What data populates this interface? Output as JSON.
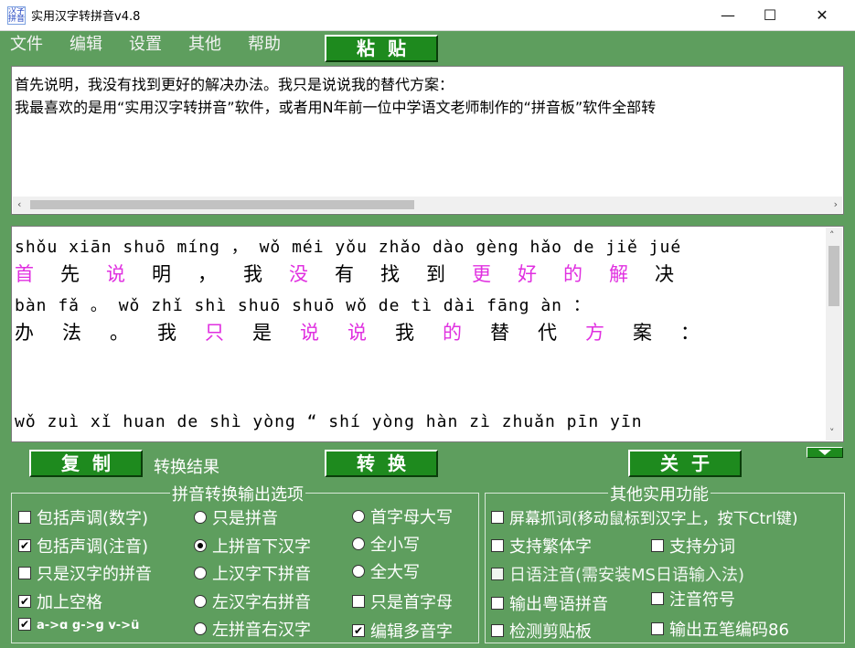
{
  "window": {
    "title": "实用汉字转拼音v4.8",
    "icon_text": "汉字拼音",
    "minimize": "—",
    "maximize": "☐",
    "close": "✕"
  },
  "menu": [
    "文件",
    "编辑",
    "设置",
    "其他",
    "帮助"
  ],
  "buttons": {
    "paste": "粘贴",
    "copy": "复制",
    "convert": "转换",
    "about": "关于"
  },
  "input": {
    "lines": [
      "首先说明，我没有找到更好的解决办法。我只是说说我的替代方案：",
      "我最喜欢的是用“实用汉字转拼音”软件，或者用N年前一位中学语文老师制作的“拼音板”软件全部转"
    ]
  },
  "result_label": "转换结果",
  "result": {
    "pinyin1": "shǒu xiān shuō míng ，  wǒ méi yǒu zhǎo dào gèng hǎo de jiě jué",
    "hanzi1": [
      {
        "t": "首",
        "m": true
      },
      {
        "t": "先",
        "m": false
      },
      {
        "t": "说",
        "m": true
      },
      {
        "t": "明",
        "m": false
      },
      {
        "t": "，",
        "m": false
      },
      {
        "t": "我",
        "m": false
      },
      {
        "t": "没",
        "m": true
      },
      {
        "t": "有",
        "m": false
      },
      {
        "t": "找",
        "m": false
      },
      {
        "t": "到",
        "m": false
      },
      {
        "t": "更",
        "m": true
      },
      {
        "t": "好",
        "m": true
      },
      {
        "t": "的",
        "m": true
      },
      {
        "t": "解",
        "m": true
      },
      {
        "t": "决",
        "m": false
      }
    ],
    "pinyin2": "bàn fǎ 。 wǒ zhǐ shì shuō shuō wǒ de tì dài fāng àn ：",
    "hanzi2": [
      {
        "t": "办",
        "m": false
      },
      {
        "t": "法",
        "m": false
      },
      {
        "t": "。",
        "m": false
      },
      {
        "t": "我",
        "m": false
      },
      {
        "t": "只",
        "m": true
      },
      {
        "t": "是",
        "m": false
      },
      {
        "t": "说",
        "m": true
      },
      {
        "t": "说",
        "m": true
      },
      {
        "t": "我",
        "m": false
      },
      {
        "t": "的",
        "m": true
      },
      {
        "t": "替",
        "m": false
      },
      {
        "t": "代",
        "m": false
      },
      {
        "t": "方",
        "m": true
      },
      {
        "t": "案",
        "m": false
      },
      {
        "t": "：",
        "m": false
      }
    ],
    "pinyin3": "wǒ zuì xǐ huan de shì yòng “ shí yòng hàn zì zhuǎn pīn yīn"
  },
  "options_group": {
    "title": "拼音转换输出选项",
    "col1": [
      {
        "label": "包括声调(数字)",
        "checked": false
      },
      {
        "label": "包括声调(注音)",
        "checked": true
      },
      {
        "label": "只是汉字的拼音",
        "checked": false
      },
      {
        "label": "加上空格",
        "checked": true
      },
      {
        "label": "a->ɑ g->ɡ v->ü",
        "checked": true
      }
    ],
    "col2": [
      {
        "label": "只是拼音",
        "checked": false
      },
      {
        "label": "上拼音下汉字",
        "checked": true
      },
      {
        "label": "上汉字下拼音",
        "checked": false
      },
      {
        "label": "左汉字右拼音",
        "checked": false
      },
      {
        "label": "左拼音右汉字",
        "checked": false
      }
    ],
    "col3": [
      {
        "label": "首字母大写",
        "checked": false
      },
      {
        "label": "全小写",
        "checked": false
      },
      {
        "label": "全大写",
        "checked": false
      },
      {
        "label": "只是首字母",
        "checked": false
      },
      {
        "label": "编辑多音字",
        "checked": true
      }
    ]
  },
  "other_group": {
    "title": "其他实用功能",
    "items": [
      {
        "label": "屏幕抓词(移动鼠标到汉字上，按下Ctrl键)",
        "checked": false
      },
      {
        "label": "支持繁体字",
        "checked": false
      },
      {
        "label": "支持分词",
        "checked": false
      },
      {
        "label": "日语注音(需安装MS日语输入法)",
        "checked": false
      },
      {
        "label": "输出粤语拼音",
        "checked": false
      },
      {
        "label": "注音符号",
        "checked": false
      },
      {
        "label": "检测剪贴板",
        "checked": false
      },
      {
        "label": "输出五笔编码86",
        "checked": false
      }
    ]
  },
  "colors": {
    "background": "#5e9e5e",
    "button": "#1e8a1e",
    "highlight": "#e030e0"
  }
}
